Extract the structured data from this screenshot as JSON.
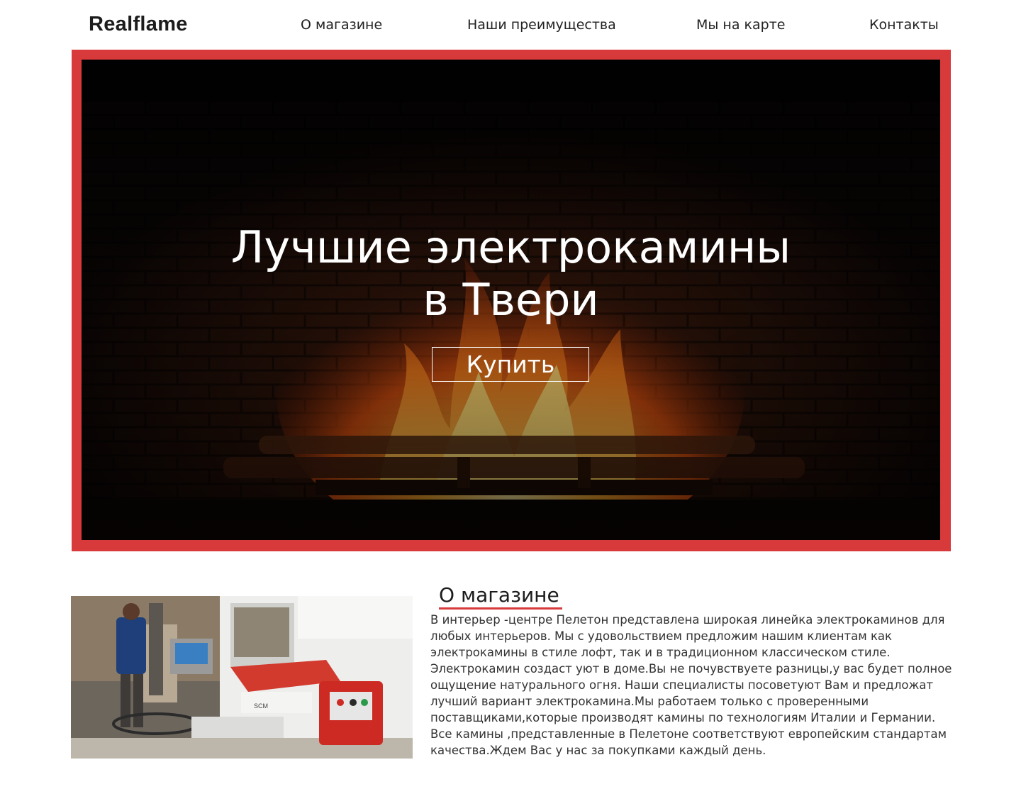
{
  "header": {
    "logo": "Realflame",
    "nav": [
      {
        "label": "О магазине"
      },
      {
        "label": "Наши преимущества"
      },
      {
        "label": "Мы на карте"
      },
      {
        "label": "Контакты"
      }
    ]
  },
  "hero": {
    "title_line1": "Лучшие электрокамины",
    "title_line2": "в Твери",
    "button_label": "Купить",
    "frame_color": "#d8393b"
  },
  "about": {
    "heading": "О магазине",
    "text": "В интерьер -центре Пелетон представлена широкая линейка электрокаминов для любых интерьеров. Мы с удовольствием предложим нашим клиентам как электрокамины в стиле лофт, так и в традиционном классическом стиле. Электрокамин создаст уют в доме.Вы не почувствуете разницы,у вас будет полное ощущение натурального огня. Наши специалисты посоветуют Вам и предложат лучший вариант электрокамина.Мы работаем только с проверенными поставщиками,которые производят камины по технологиям Италии и Германии. Все камины ,представленные в Пелетоне соответствуют европейским стандартам качества.Ждем Вас у нас за покупками каждый день.",
    "photo_brand": "SCM",
    "accent_color": "#d8393b"
  }
}
